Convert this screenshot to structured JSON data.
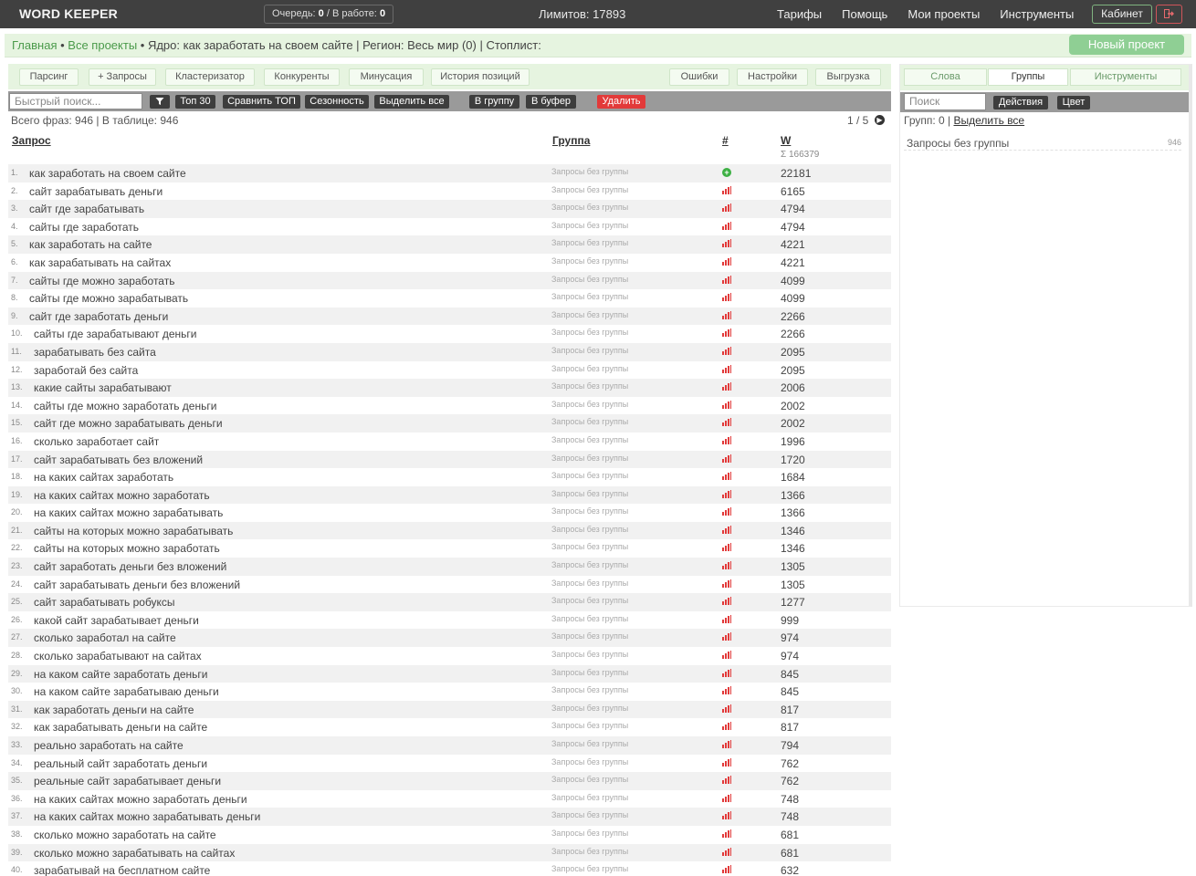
{
  "topbar": {
    "logo": "WORD KEEPER",
    "queue_label": "Очередь:",
    "queue_value": "0",
    "inwork_label": "/ В работе:",
    "inwork_value": "0",
    "limits": "Лимитов: 17893",
    "nav": [
      "Тарифы",
      "Помощь",
      "Мои проекты",
      "Инструменты"
    ],
    "cabinet": "Кабинет",
    "logout_icon": "logout-icon"
  },
  "breadcrumb": {
    "home": "Главная",
    "sep": "•",
    "projects": "Все проекты",
    "rest": "• Ядро: как заработать на своем сайте | Регион: Весь мир (0) | Стоплист:",
    "new_project": "Новый проект"
  },
  "tabs": [
    "Парсинг",
    "+ Запросы",
    "Кластеризатор",
    "Конкуренты",
    "Минусация",
    "История позиций",
    "Ошибки",
    "Настройки",
    "Выгрузка"
  ],
  "toolbar": {
    "search_placeholder": "Быстрый поиск...",
    "filter_icon": "filter-icon",
    "top30": "Топ 30",
    "compare": "Сравнить ТОП",
    "seasonality": "Сезонность",
    "select_all": "Выделить все",
    "to_group": "В группу",
    "to_buffer": "В буфер",
    "delete": "Удалить"
  },
  "summary": {
    "totals": "Всего фраз: 946 | В таблице: 946",
    "pager": "1 / 5"
  },
  "columns": {
    "query": "Запрос",
    "group": "Группа",
    "hash": "#",
    "w": "W",
    "w_sum": "Σ 166379"
  },
  "colors": {
    "accent_green": "#8fcf94",
    "bar_red": "#e23a3a",
    "plus_green": "#3cb043"
  },
  "rows": [
    {
      "n": "1.",
      "q": "как заработать на своем сайте",
      "g": "Запросы без группы",
      "icon": "plus-icon",
      "w": "22181"
    },
    {
      "n": "2.",
      "q": "сайт зарабатывать деньги",
      "g": "Запросы без группы",
      "icon": "bars-icon",
      "w": "6165"
    },
    {
      "n": "3.",
      "q": "сайт где зарабатывать",
      "g": "Запросы без группы",
      "icon": "bars-icon",
      "w": "4794"
    },
    {
      "n": "4.",
      "q": "сайты где заработать",
      "g": "Запросы без группы",
      "icon": "bars-icon",
      "w": "4794"
    },
    {
      "n": "5.",
      "q": "как заработать на сайте",
      "g": "Запросы без группы",
      "icon": "bars-icon",
      "w": "4221"
    },
    {
      "n": "6.",
      "q": "как зарабатывать на сайтах",
      "g": "Запросы без группы",
      "icon": "bars-icon",
      "w": "4221"
    },
    {
      "n": "7.",
      "q": "сайты где можно заработать",
      "g": "Запросы без группы",
      "icon": "bars-icon",
      "w": "4099"
    },
    {
      "n": "8.",
      "q": "сайты где можно зарабатывать",
      "g": "Запросы без группы",
      "icon": "bars-icon",
      "w": "4099"
    },
    {
      "n": "9.",
      "q": "сайт где заработать деньги",
      "g": "Запросы без группы",
      "icon": "bars-icon",
      "w": "2266"
    },
    {
      "n": "10.",
      "q": "сайты где зарабатывают деньги",
      "g": "Запросы без группы",
      "icon": "bars-icon",
      "w": "2266"
    },
    {
      "n": "11.",
      "q": "зарабатывать без сайта",
      "g": "Запросы без группы",
      "icon": "bars-icon",
      "w": "2095"
    },
    {
      "n": "12.",
      "q": "заработай без сайта",
      "g": "Запросы без группы",
      "icon": "bars-icon",
      "w": "2095"
    },
    {
      "n": "13.",
      "q": "какие сайты зарабатывают",
      "g": "Запросы без группы",
      "icon": "bars-icon",
      "w": "2006"
    },
    {
      "n": "14.",
      "q": "сайты где можно заработать деньги",
      "g": "Запросы без группы",
      "icon": "bars-icon",
      "w": "2002"
    },
    {
      "n": "15.",
      "q": "сайт где можно зарабатывать деньги",
      "g": "Запросы без группы",
      "icon": "bars-icon",
      "w": "2002"
    },
    {
      "n": "16.",
      "q": "сколько заработает сайт",
      "g": "Запросы без группы",
      "icon": "bars-icon",
      "w": "1996"
    },
    {
      "n": "17.",
      "q": "сайт зарабатывать без вложений",
      "g": "Запросы без группы",
      "icon": "bars-icon",
      "w": "1720"
    },
    {
      "n": "18.",
      "q": "на каких сайтах заработать",
      "g": "Запросы без группы",
      "icon": "bars-icon",
      "w": "1684"
    },
    {
      "n": "19.",
      "q": "на каких сайтах можно заработать",
      "g": "Запросы без группы",
      "icon": "bars-icon",
      "w": "1366"
    },
    {
      "n": "20.",
      "q": "на каких сайтах можно зарабатывать",
      "g": "Запросы без группы",
      "icon": "bars-icon",
      "w": "1366"
    },
    {
      "n": "21.",
      "q": "сайты на которых можно зарабатывать",
      "g": "Запросы без группы",
      "icon": "bars-icon",
      "w": "1346"
    },
    {
      "n": "22.",
      "q": "сайты на которых можно заработать",
      "g": "Запросы без группы",
      "icon": "bars-icon",
      "w": "1346"
    },
    {
      "n": "23.",
      "q": "сайт заработать деньги без вложений",
      "g": "Запросы без группы",
      "icon": "bars-icon",
      "w": "1305"
    },
    {
      "n": "24.",
      "q": "сайт зарабатывать деньги без вложений",
      "g": "Запросы без группы",
      "icon": "bars-icon",
      "w": "1305"
    },
    {
      "n": "25.",
      "q": "сайт зарабатывать робуксы",
      "g": "Запросы без группы",
      "icon": "bars-icon",
      "w": "1277"
    },
    {
      "n": "26.",
      "q": "какой сайт зарабатывает деньги",
      "g": "Запросы без группы",
      "icon": "bars-icon",
      "w": "999"
    },
    {
      "n": "27.",
      "q": "сколько заработал на сайте",
      "g": "Запросы без группы",
      "icon": "bars-icon",
      "w": "974"
    },
    {
      "n": "28.",
      "q": "сколько зарабатывают на сайтах",
      "g": "Запросы без группы",
      "icon": "bars-icon",
      "w": "974"
    },
    {
      "n": "29.",
      "q": "на каком сайте заработать деньги",
      "g": "Запросы без группы",
      "icon": "bars-icon",
      "w": "845"
    },
    {
      "n": "30.",
      "q": "на каком сайте зарабатываю деньги",
      "g": "Запросы без группы",
      "icon": "bars-icon",
      "w": "845"
    },
    {
      "n": "31.",
      "q": "как заработать деньги на сайте",
      "g": "Запросы без группы",
      "icon": "bars-icon",
      "w": "817"
    },
    {
      "n": "32.",
      "q": "как зарабатывать деньги на сайте",
      "g": "Запросы без группы",
      "icon": "bars-icon",
      "w": "817"
    },
    {
      "n": "33.",
      "q": "реально заработать на сайте",
      "g": "Запросы без группы",
      "icon": "bars-icon",
      "w": "794"
    },
    {
      "n": "34.",
      "q": "реальный сайт заработать деньги",
      "g": "Запросы без группы",
      "icon": "bars-icon",
      "w": "762"
    },
    {
      "n": "35.",
      "q": "реальные сайт зарабатывает деньги",
      "g": "Запросы без группы",
      "icon": "bars-icon",
      "w": "762"
    },
    {
      "n": "36.",
      "q": "на каких сайтах можно заработать деньги",
      "g": "Запросы без группы",
      "icon": "bars-icon",
      "w": "748"
    },
    {
      "n": "37.",
      "q": "на каких сайтах можно зарабатывать деньги",
      "g": "Запросы без группы",
      "icon": "bars-icon",
      "w": "748"
    },
    {
      "n": "38.",
      "q": "сколько можно заработать на сайте",
      "g": "Запросы без группы",
      "icon": "bars-icon",
      "w": "681"
    },
    {
      "n": "39.",
      "q": "сколько можно зарабатывать на сайтах",
      "g": "Запросы без группы",
      "icon": "bars-icon",
      "w": "681"
    },
    {
      "n": "40.",
      "q": "зарабатывай на бесплатном сайте",
      "g": "Запросы без группы",
      "icon": "bars-icon",
      "w": "632"
    }
  ],
  "right": {
    "tabs": [
      "Слова",
      "Группы",
      "Инструменты"
    ],
    "search_placeholder": "Поиск",
    "actions": "Действия",
    "color": "Цвет",
    "groups_count": "Групп: 0 |",
    "select_all": "Выделить все",
    "group_name": "Запросы без группы",
    "group_count": "946"
  }
}
